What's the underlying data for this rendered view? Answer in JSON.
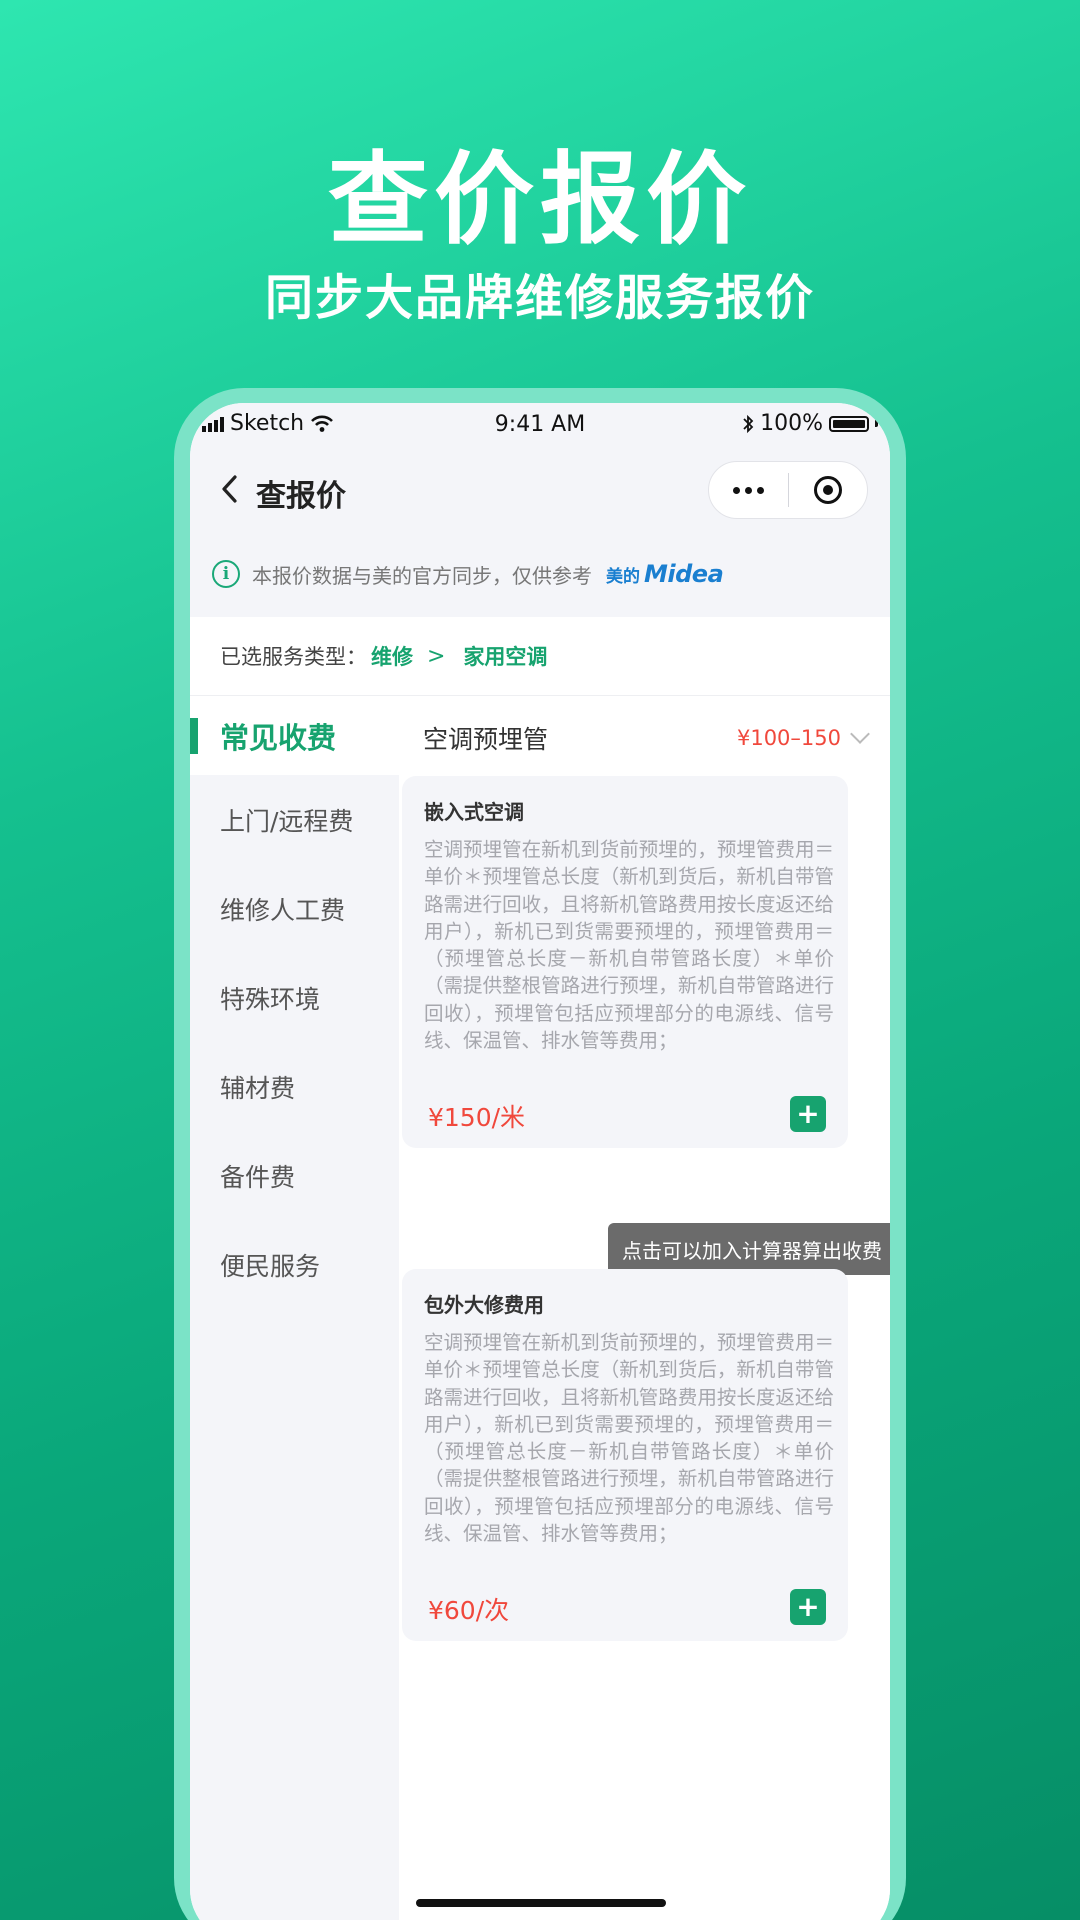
{
  "poster": {
    "headline": "查价报价",
    "subhead": "同步大品牌维修服务报价"
  },
  "statusbar": {
    "carrier": "Sketch",
    "time": "9:41 AM",
    "battery": "100%"
  },
  "navbar": {
    "title": "查报价"
  },
  "notice": {
    "text": "本报价数据与美的官方同步，仅供参考",
    "brand_cn": "美的",
    "brand_logo": "Midea"
  },
  "service": {
    "label": "已选服务类型：",
    "crumbs": [
      "维修",
      "家用空调"
    ],
    "separator": ">"
  },
  "sidebar": {
    "items": [
      {
        "label": "常见收费",
        "active": true
      },
      {
        "label": "上门/远程费"
      },
      {
        "label": "维修人工费"
      },
      {
        "label": "特殊环境"
      },
      {
        "label": "辅材费"
      },
      {
        "label": "备件费"
      },
      {
        "label": "便民服务"
      }
    ]
  },
  "content": {
    "category": {
      "title": "空调预埋管",
      "range": "¥100–150"
    },
    "cards": [
      {
        "title": "嵌入式空调",
        "desc": "空调预埋管在新机到货前预埋的，预埋管费用＝单价＊预埋管总长度（新机到货后，新机自带管路需进行回收，且将新机管路费用按长度返还给用户），新机已到货需要预埋的，预埋管费用＝（预埋管总长度－新机自带管路长度）＊单价（需提供整根管路进行预埋，新机自带管路进行回收），预埋管包括应预埋部分的电源线、信号线、保温管、排水管等费用；",
        "price": "¥150/米"
      },
      {
        "title": "包外大修费用",
        "desc": "空调预埋管在新机到货前预埋的，预埋管费用＝单价＊预埋管总长度（新机到货后，新机自带管路需进行回收，且将新机管路费用按长度返还给用户），新机已到货需要预埋的，预埋管费用＝（预埋管总长度－新机自带管路长度）＊单价（需提供整根管路进行预埋，新机自带管路进行回收），预埋管包括应预埋部分的电源线、信号线、保温管、排水管等费用；",
        "price": "¥60/次"
      }
    ],
    "tooltip": "点击可以加入计算器算出收费"
  },
  "colors": {
    "accent": "#17a36f",
    "price": "#f0483c",
    "background_start": "#2ee6b0",
    "background_end": "#068e66"
  }
}
